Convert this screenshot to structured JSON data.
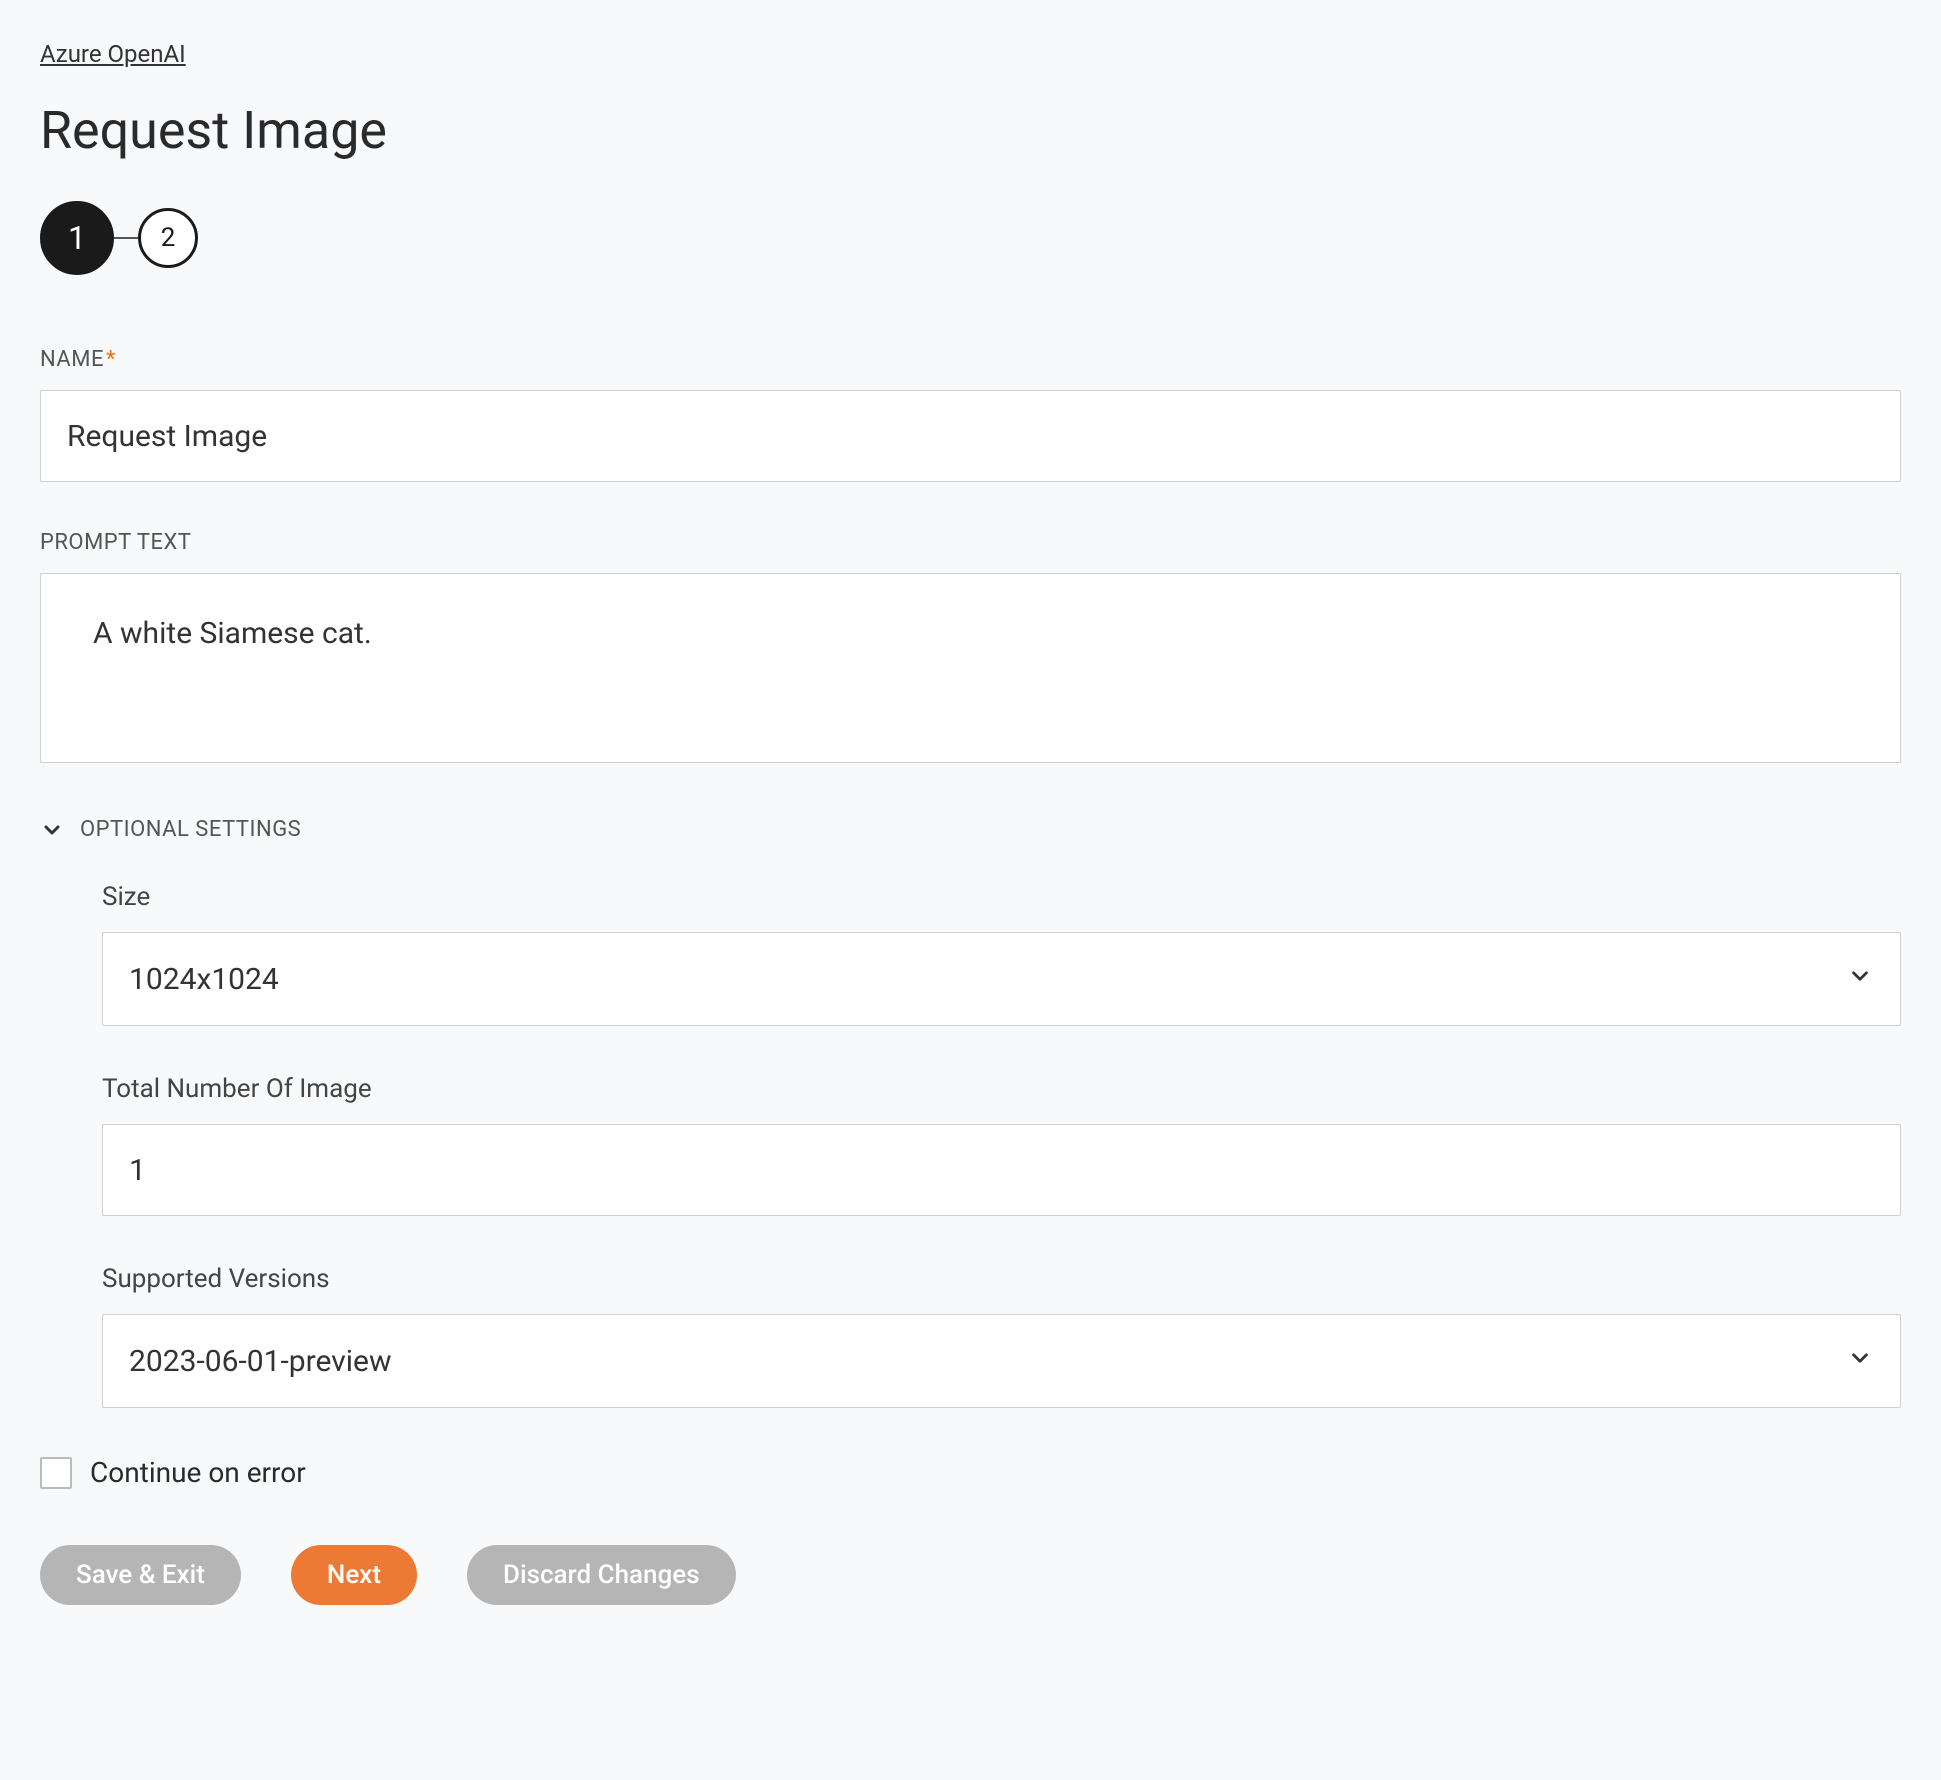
{
  "breadcrumb": {
    "label": "Azure OpenAI"
  },
  "page": {
    "title": "Request Image"
  },
  "stepper": {
    "steps": [
      "1",
      "2"
    ],
    "active": 0
  },
  "fields": {
    "name": {
      "label": "NAME",
      "required": true,
      "value": "Request Image"
    },
    "prompt": {
      "label": "PROMPT TEXT",
      "value": "A white Siamese cat."
    }
  },
  "optional": {
    "header": "OPTIONAL SETTINGS",
    "expanded": true,
    "size": {
      "label": "Size",
      "value": "1024x1024"
    },
    "totalNumber": {
      "label": "Total Number Of Image",
      "value": "1"
    },
    "supportedVersions": {
      "label": "Supported Versions",
      "value": "2023-06-01-preview"
    }
  },
  "continueOnError": {
    "label": "Continue on error",
    "checked": false
  },
  "buttons": {
    "saveExit": "Save & Exit",
    "next": "Next",
    "discard": "Discard Changes"
  }
}
